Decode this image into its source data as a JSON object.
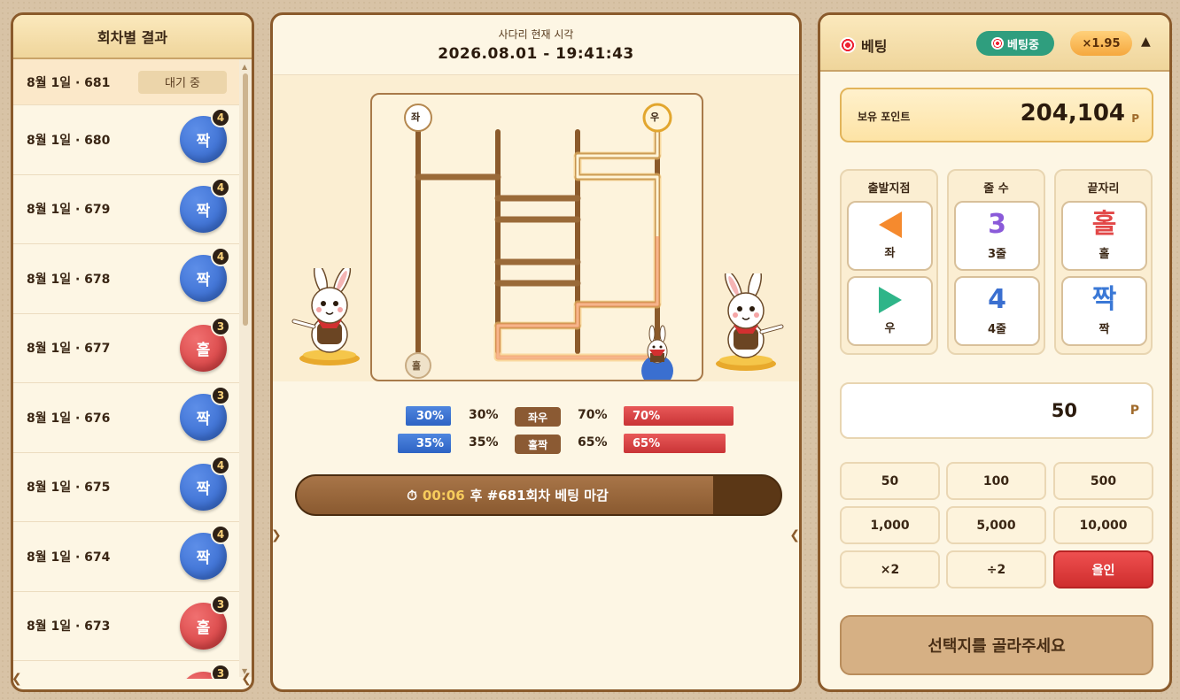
{
  "left": {
    "title": "회차별 결과",
    "pending": {
      "label": "8월 1일 · 681",
      "status": "대기 중"
    },
    "rows": [
      {
        "label": "8월 1일 · 680",
        "result": "짝",
        "lines": "4",
        "color": "blue"
      },
      {
        "label": "8월 1일 · 679",
        "result": "짝",
        "lines": "4",
        "color": "blue"
      },
      {
        "label": "8월 1일 · 678",
        "result": "짝",
        "lines": "4",
        "color": "blue"
      },
      {
        "label": "8월 1일 · 677",
        "result": "홀",
        "lines": "3",
        "color": "red"
      },
      {
        "label": "8월 1일 · 676",
        "result": "짝",
        "lines": "3",
        "color": "blue"
      },
      {
        "label": "8월 1일 · 675",
        "result": "짝",
        "lines": "4",
        "color": "blue"
      },
      {
        "label": "8월 1일 · 674",
        "result": "짝",
        "lines": "4",
        "color": "blue"
      },
      {
        "label": "8월 1일 · 673",
        "result": "홀",
        "lines": "3",
        "color": "red"
      },
      {
        "label": "",
        "result": "",
        "lines": "3",
        "color": "red"
      }
    ]
  },
  "center": {
    "subtitle": "사다리 현재 시각",
    "time": "2026.08.01 - 19:41:43",
    "ladder": {
      "start_left": "좌",
      "start_right": "우",
      "end_left": "홀"
    },
    "stats": [
      {
        "left_bar": "30%",
        "left_pct": "30%",
        "tag": "좌우",
        "right_pct": "70%",
        "right_bar": "70%",
        "left_value": 30,
        "right_value": 70
      },
      {
        "left_bar": "35%",
        "left_pct": "35%",
        "tag": "홀짝",
        "right_pct": "65%",
        "right_bar": "65%",
        "left_value": 35,
        "right_value": 65
      }
    ],
    "timer": {
      "icon": "⏱",
      "countdown": "00:06",
      "text": "후 #681회차 베팅 마감",
      "progress": 0.86
    }
  },
  "right": {
    "title": "베팅",
    "status_pill": "베팅중",
    "odds": "×1.95",
    "points_label": "보유 포인트",
    "points_value": "204,104",
    "points_unit": "P",
    "groups": [
      {
        "title": "출발지점",
        "options": [
          {
            "icon": "triangle-left",
            "label": "좌"
          },
          {
            "icon": "triangle-right",
            "label": "우"
          }
        ]
      },
      {
        "title": "줄 수",
        "options": [
          {
            "big": "3",
            "label": "3줄",
            "color": "#8a5ad9"
          },
          {
            "big": "4",
            "label": "4줄",
            "color": "#3a6fd0"
          }
        ]
      },
      {
        "title": "끝자리",
        "options": [
          {
            "big": "홀",
            "label": "홀",
            "color": "#e24848"
          },
          {
            "big": "짝",
            "label": "짝",
            "color": "#3a78d6"
          }
        ]
      }
    ],
    "amount_value": "50",
    "amount_unit": "P",
    "chips": [
      "50",
      "100",
      "500",
      "1,000",
      "5,000",
      "10,000",
      "×2",
      "÷2",
      "올인"
    ],
    "submit": "선택지를 골라주세요"
  }
}
